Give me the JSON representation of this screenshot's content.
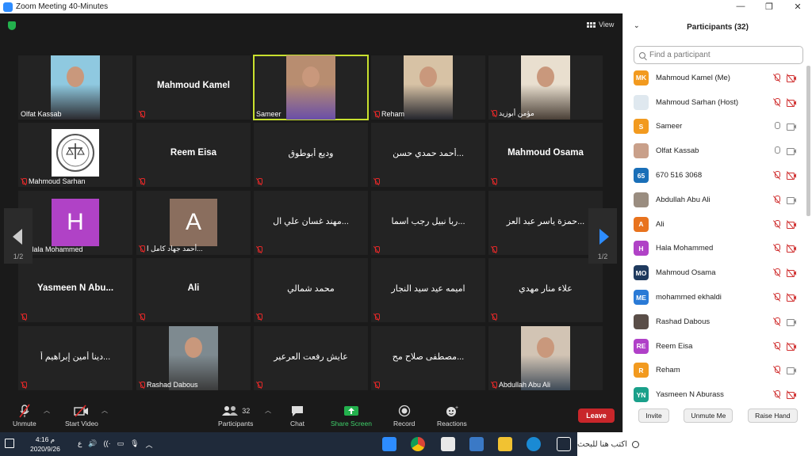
{
  "window": {
    "title": "Zoom Meeting 40-Minutes",
    "minimize": "—",
    "maximize": "❐",
    "close": "✕"
  },
  "meeting": {
    "view_label": "View",
    "page_left": "1/2",
    "page_right": "1/2",
    "tiles": [
      {
        "name": "Olfat Kassab",
        "type": "video",
        "muted": false,
        "photo": "person-hijab"
      },
      {
        "name": "Mahmoud Kamel",
        "type": "name",
        "muted": true
      },
      {
        "name": "Sameer",
        "type": "video",
        "muted": false,
        "active": true,
        "photo": "older-man"
      },
      {
        "name": "Reham",
        "type": "video",
        "muted": true,
        "photo": "person-hijab-dark"
      },
      {
        "name": "مؤمن أبوزيد",
        "type": "video",
        "muted": true,
        "photo": "man-room"
      },
      {
        "name": "Mahmoud Sarhan",
        "type": "logo",
        "muted": true
      },
      {
        "name": "Reem Eisa",
        "type": "name",
        "muted": true
      },
      {
        "name": "وديع أبوطوق",
        "type": "name-ar",
        "muted": true
      },
      {
        "name": "أحمد حمدي حسن...",
        "type": "name-ar",
        "muted": true
      },
      {
        "name": "Mahmoud Osama",
        "type": "name",
        "muted": true
      },
      {
        "name": "Hala Mohammed",
        "type": "letter",
        "letter": "H",
        "color": "#b042c6",
        "muted": true
      },
      {
        "name": "أحمد جهاد كامل ا...",
        "type": "letter",
        "letter": "A",
        "color": "#8a6e5e",
        "muted": true
      },
      {
        "name": "مهند غسان علي ال...",
        "type": "name-ar",
        "muted": true
      },
      {
        "name": "ربا نبيل رجب اسما...",
        "type": "name-ar",
        "muted": true
      },
      {
        "name": "حمزة ياسر عبد العز...",
        "type": "name-ar",
        "muted": true
      },
      {
        "name": "Yasmeen N Abu...",
        "type": "name",
        "muted": true
      },
      {
        "name": "Ali",
        "type": "name",
        "muted": true
      },
      {
        "name": "محمد شمالي",
        "type": "name-ar",
        "muted": true
      },
      {
        "name": "اميمه عيد سيد النجار",
        "type": "name-ar",
        "muted": true
      },
      {
        "name": "علاء منار مهدي",
        "type": "name-ar",
        "muted": true
      },
      {
        "name": "دينا أمين إبراهيم أ...",
        "type": "name-ar",
        "muted": true
      },
      {
        "name": "Rashad Dabous",
        "type": "video",
        "muted": true,
        "photo": "man-flag"
      },
      {
        "name": "عايش رفعت العرعير",
        "type": "name-ar",
        "muted": true
      },
      {
        "name": "مصطفى صلاح مح...",
        "type": "name-ar",
        "muted": true
      },
      {
        "name": "Abdullah Abu Ali",
        "type": "video",
        "muted": true,
        "photo": "young-man"
      }
    ]
  },
  "toolbar": {
    "unmute": "Unmute",
    "start_video": "Start Video",
    "participants": "Participants",
    "participants_count": "32",
    "chat": "Chat",
    "share_screen": "Share Screen",
    "record": "Record",
    "reactions": "Reactions",
    "leave": "Leave"
  },
  "panel": {
    "title": "Participants (32)",
    "search_placeholder": "Find a participant",
    "participants": [
      {
        "initials": "MK",
        "color": "#f29a1f",
        "name": "Mahmoud Kamel (Me)",
        "mic": "off",
        "cam": "off"
      },
      {
        "initials": "",
        "color": "#dfe8ef",
        "name": "Mahmoud Sarhan (Host)",
        "mic": "off",
        "cam": "off"
      },
      {
        "initials": "S",
        "color": "#f29a1f",
        "name": "Sameer",
        "mic": "on",
        "cam": "on"
      },
      {
        "initials": "",
        "color": "#c9a08a",
        "name": "Olfat Kassab",
        "mic": "on",
        "cam": "on"
      },
      {
        "initials": "65",
        "color": "#1a6fb8",
        "name": "670 516 3068",
        "mic": "off",
        "cam": "off"
      },
      {
        "initials": "",
        "color": "#9a8d80",
        "name": "Abdullah Abu Ali",
        "mic": "off",
        "cam": "on"
      },
      {
        "initials": "A",
        "color": "#e8731e",
        "name": "Ali",
        "mic": "off",
        "cam": "off"
      },
      {
        "initials": "H",
        "color": "#b042c6",
        "name": "Hala Mohammed",
        "mic": "off",
        "cam": "off"
      },
      {
        "initials": "MO",
        "color": "#1f3a5e",
        "name": "Mahmoud Osama",
        "mic": "off",
        "cam": "off"
      },
      {
        "initials": "ME",
        "color": "#2a7ad6",
        "name": "mohammed ekhaldi",
        "mic": "off",
        "cam": "off"
      },
      {
        "initials": "",
        "color": "#5a4e48",
        "name": "Rashad Dabous",
        "mic": "off",
        "cam": "on"
      },
      {
        "initials": "RE",
        "color": "#b040c8",
        "name": "Reem Eisa",
        "mic": "off",
        "cam": "off"
      },
      {
        "initials": "R",
        "color": "#f29a1f",
        "name": "Reham",
        "mic": "off",
        "cam": "on"
      },
      {
        "initials": "YN",
        "color": "#1aa08a",
        "name": "Yasmeen N Aburass",
        "mic": "off",
        "cam": "off"
      }
    ],
    "invite": "Invite",
    "unmute_me": "Unmute Me",
    "raise_hand": "Raise Hand"
  },
  "taskbar": {
    "time": "4:16 م",
    "date": "2020/9/26",
    "lang": "ع",
    "search_text": "اكتب هنا للبحث"
  }
}
